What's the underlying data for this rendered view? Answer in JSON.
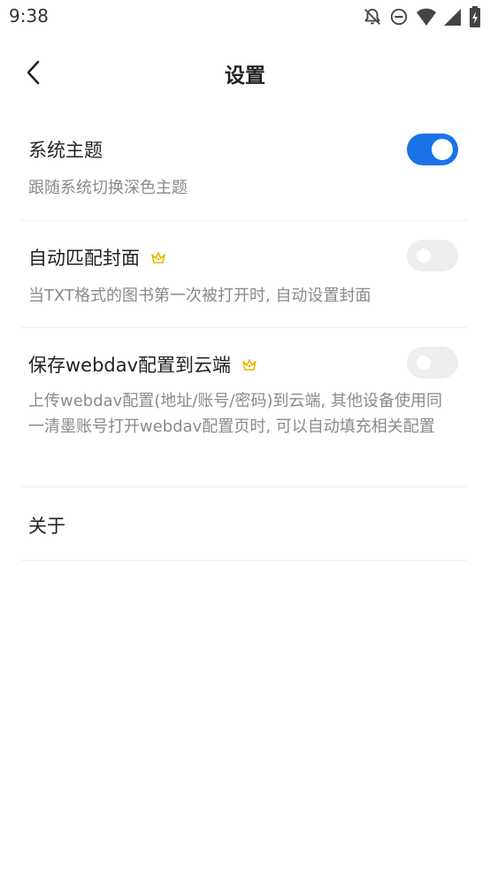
{
  "status_bar": {
    "time": "9:38",
    "icons": [
      "bell-off-icon",
      "do-not-disturb-icon",
      "wifi-icon",
      "signal-icon",
      "battery-charging-icon"
    ]
  },
  "header": {
    "back_icon": "chevron-left-icon",
    "title": "设置"
  },
  "settings": {
    "items": [
      {
        "title": "系统主题",
        "description": "跟随系统切换深色主题",
        "premium": false,
        "toggle_on": true
      },
      {
        "title": "自动匹配封面",
        "description": "当TXT格式的图书第一次被打开时, 自动设置封面",
        "premium": true,
        "toggle_on": false
      },
      {
        "title": "保存webdav配置到云端",
        "description": "上传webdav配置(地址/账号/密码)到云端, 其他设备使用同一清墨账号打开webdav配置页时, 可以自动填充相关配置",
        "premium": true,
        "toggle_on": false
      },
      {
        "title": "关于"
      }
    ]
  },
  "colors": {
    "accent": "#1a73e8",
    "crown": "#e6b800",
    "secondary_text": "#8a8a8a"
  }
}
